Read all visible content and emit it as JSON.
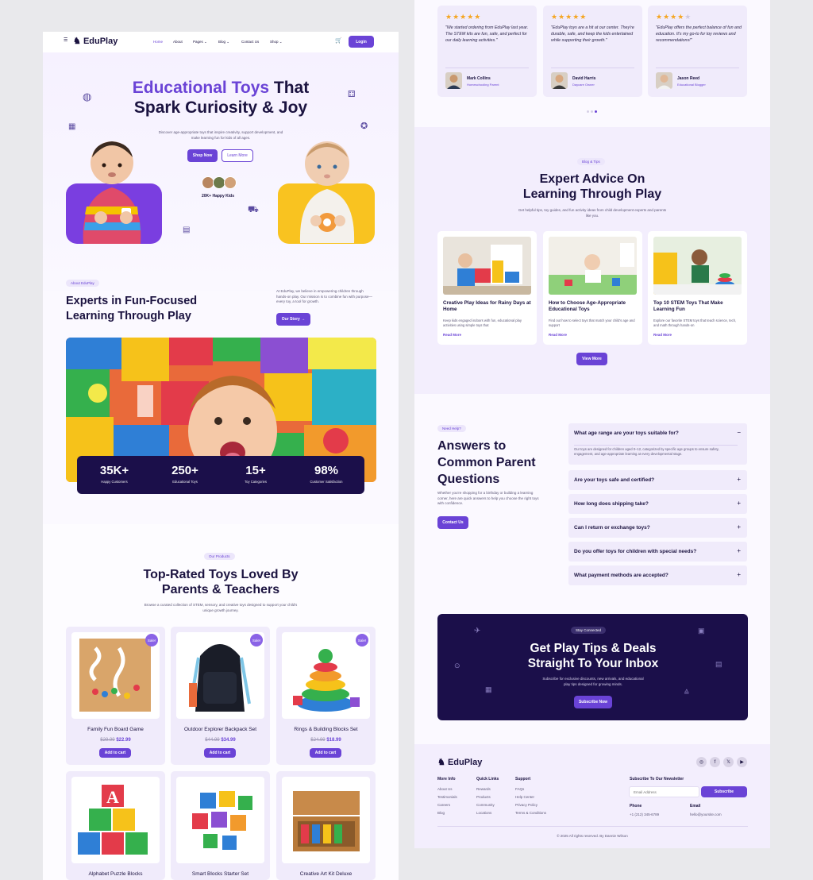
{
  "nav": {
    "logo": "EduPlay",
    "items": [
      "Home",
      "About",
      "Pages",
      "Blog",
      "Contact Us",
      "Shop"
    ],
    "login": "Login"
  },
  "hero": {
    "title_accent": "Educational Toys",
    "title_rest": "That",
    "title_line2": "Spark Curiosity & Joy",
    "subtitle": "Discover age-appropriate toys that inspire creativity, support development, and make learning fun for kids of all ages.",
    "shop_now": "Shop Now",
    "learn_more": "Learn More",
    "happy_kids": "20K+ Happy Kids"
  },
  "about": {
    "tag": "About EduPlay",
    "title": "Experts in Fun-Focused Learning Through Play",
    "text": "At EduPlay, we believe in empowering children through hands-on play. Our mission is to combine fun with purpose—every toy, a tool for growth.",
    "button": "Our Story →"
  },
  "stats": [
    {
      "value": "35K+",
      "label": "Happy Customers"
    },
    {
      "value": "250+",
      "label": "Educational Toys"
    },
    {
      "value": "15+",
      "label": "Toy Categories"
    },
    {
      "value": "98%",
      "label": "Customer Satisfaction"
    }
  ],
  "products": {
    "tag": "Our Products",
    "title": "Top-Rated Toys Loved By Parents & Teachers",
    "subtitle": "Browse a curated collection of STEM, sensory, and creative toys designed to support your child's unique growth journey.",
    "sale_label": "Sale!",
    "add_to_cart": "Add to cart",
    "items": [
      {
        "name": "Family Fun Board Game",
        "old": "$29.99",
        "price": "$22.99"
      },
      {
        "name": "Outdoor Explorer Backpack Set",
        "old": "$44.99",
        "price": "$34.99"
      },
      {
        "name": "Rings & Building Blocks Set",
        "old": "$24.99",
        "price": "$18.99"
      },
      {
        "name": "Alphabet Puzzle Blocks"
      },
      {
        "name": "Smart Blocks Starter Set"
      },
      {
        "name": "Creative Art Kit Deluxe"
      }
    ]
  },
  "testimonials": [
    {
      "rating": 5,
      "stars": "★★★★★",
      "quote": "\"We started ordering from EduPlay last year. The STEM kits are fun, safe, and perfect for our daily learning activities.\"",
      "name": "Mark Collins",
      "role": "Homeschooling Parent"
    },
    {
      "rating": 5,
      "stars": "★★★★★",
      "quote": "\"EduPlay toys are a hit at our center. They're durable, safe, and keep the kids entertained while supporting their growth.\"",
      "name": "David Harris",
      "role": "Daycare Owner"
    },
    {
      "rating": 4,
      "stars": "★★★★",
      "stars_off": "★",
      "quote": "\"EduPlay offers the perfect balance of fun and education. It's my go-to for toy reviews and recommendations!\"",
      "name": "Jason Reed",
      "role": "Educational Blogger"
    }
  ],
  "blog": {
    "tag": "Blog & Tips",
    "title": "Expert Advice On Learning Through Play",
    "subtitle": "Get helpful tips, toy guides, and fun activity ideas from child development experts and parents like you.",
    "read_more": "Read More",
    "view_more": "View More",
    "posts": [
      {
        "title": "Creative Play Ideas for Rainy Days at Home",
        "text": "Keep kids engaged indoors with fun, educational play activities using simple toys that"
      },
      {
        "title": "How to Choose Age-Appropriate Educational Toys",
        "text": "Find out how to select toys that match your child's age and support"
      },
      {
        "title": "Top 10 STEM Toys That Make Learning Fun",
        "text": "Explore our favorite STEM toys that teach science, tech, and math through hands-on"
      }
    ]
  },
  "faq": {
    "tag": "Need Help?",
    "title": "Answers to Common Parent Questions",
    "text": "Whether you're shopping for a birthday or building a learning corner, here are quick answers to help you choose the right toys with confidence.",
    "button": "Contact Us",
    "open_answer": "Our toys are designed for children aged 0–12, categorized by specific age groups to ensure safety, engagement, and age-appropriate learning at every developmental stage.",
    "items": [
      "What age range are your toys suitable for?",
      "Are your toys safe and certified?",
      "How long does shipping take?",
      "Can I return or exchange toys?",
      "Do you offer toys for children with special needs?",
      "What payment methods are accepted?"
    ]
  },
  "newsletter": {
    "tag": "Stay Connected",
    "title": "Get Play Tips & Deals Straight To Your Inbox",
    "text": "Subscribe for exclusive discounts, new arrivals, and educational play tips designed for growing minds.",
    "button": "Subscribe Now"
  },
  "footer": {
    "logo": "EduPlay",
    "col1_title": "More Info",
    "col1": [
      "About Us",
      "Testimonials",
      "Careers",
      "Blog"
    ],
    "col2_title": "Quick Links",
    "col2": [
      "Rewards",
      "Products",
      "Community",
      "Locations"
    ],
    "col3_title": "Support",
    "col3": [
      "FAQs",
      "Help Center",
      "Privacy Policy",
      "Terms & Conditions"
    ],
    "newsletter_title": "Subscribe To Our Newsletter",
    "email_placeholder": "Email Address",
    "subscribe": "Subscribe",
    "phone_label": "Phone",
    "phone": "+1 (212) 345-6789",
    "email_label": "Email",
    "email": "hello@yoursite.com",
    "copyright": "© 2025 All rights reserved. By Dannie Wilson"
  },
  "colors": {
    "accent": "#6a43d6",
    "dark": "#1b0f4a",
    "star": "#f5a623"
  }
}
